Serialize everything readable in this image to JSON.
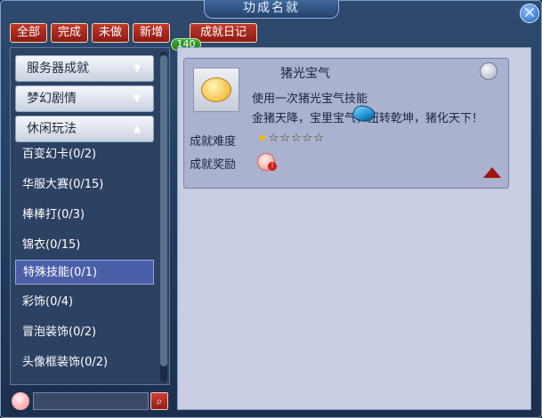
{
  "window": {
    "title": "功成名就",
    "close_label": "⨉"
  },
  "tabs": [
    {
      "label": "全部"
    },
    {
      "label": "完成"
    },
    {
      "label": "未做"
    },
    {
      "label": "新增"
    },
    {
      "label": "成就日记"
    }
  ],
  "new_badge": "140",
  "sidebar": {
    "categories": [
      {
        "label": "服务器成就",
        "chevron": "chevron-down-icon"
      },
      {
        "label": "梦幻剧情",
        "chevron": "chevron-down-icon"
      },
      {
        "label": "休闲玩法",
        "chevron": "chevron-up-icon"
      }
    ],
    "items": [
      {
        "label": "百变幻卡(0/2)"
      },
      {
        "label": "华服大赛(0/15)"
      },
      {
        "label": "棒棒打(0/3)"
      },
      {
        "label": "锦衣(0/15)"
      },
      {
        "label": "特殊技能(0/1)"
      },
      {
        "label": "彩饰(0/4)"
      },
      {
        "label": "冒泡装饰(0/2)"
      },
      {
        "label": "头像框装饰(0/2)"
      }
    ],
    "selected_index": 4
  },
  "search": {
    "placeholder": "",
    "button_icon": "search-icon"
  },
  "achievement": {
    "title": "猪光宝气",
    "desc1": "使用一次猪光宝气技能",
    "desc2": "金猪天降，宝里宝气，扭转乾坤，猪化天下！",
    "difficulty_label": "成就难度",
    "difficulty_stars": 1,
    "difficulty_max": 6,
    "reward_label": "成就奖励",
    "reward_badge": "!"
  },
  "colors": {
    "tab_red": "#c0392b",
    "selected_blue": "#4a5fa8",
    "badge_green": "#2f9a2b"
  }
}
